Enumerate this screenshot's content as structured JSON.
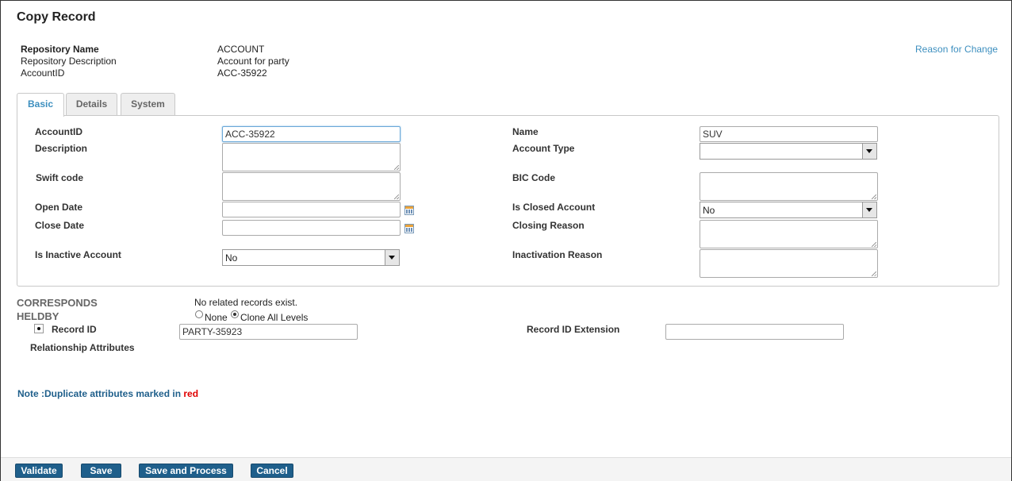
{
  "page": {
    "title": "Copy Record",
    "reason_link": "Reason for Change"
  },
  "meta": {
    "repo_name_label": "Repository Name",
    "repo_name_value": "ACCOUNT",
    "repo_desc_label": "Repository Description",
    "repo_desc_value": "Account for party",
    "account_id_label": "AccountID",
    "account_id_value": "ACC-35922"
  },
  "tabs": [
    {
      "label": "Basic"
    },
    {
      "label": "Details"
    },
    {
      "label": "System"
    }
  ],
  "form": {
    "account_id_label": "AccountID",
    "account_id_value": "ACC-35922",
    "description_label": "Description",
    "swift_label": "Swift code",
    "open_date_label": "Open Date",
    "close_date_label": "Close Date",
    "inactive_label": "Is Inactive Account",
    "inactive_value": "No",
    "name_label": "Name",
    "name_value": "SUV",
    "account_type_label": "Account Type",
    "account_type_value": "",
    "bic_label": "BIC Code",
    "closed_label": "Is Closed Account",
    "closed_value": "No",
    "closing_reason_label": "Closing Reason",
    "inactivation_reason_label": "Inactivation Reason"
  },
  "relationship": {
    "title_line1": "CORRESPONDS",
    "title_line2": "HELDBY",
    "no_records": "No related records exist.",
    "opt_none": "None",
    "opt_clone": "Clone All Levels",
    "record_id_label": "Record ID",
    "record_id_value": "PARTY-35923",
    "record_ext_label": "Record ID Extension",
    "record_ext_value": "",
    "attrs_label": "Relationship Attributes"
  },
  "note": {
    "text": "Note :Duplicate attributes marked in ",
    "red_word": "red",
    "colors": {
      "note": "#1f5f8b",
      "red": "#e00000"
    }
  },
  "buttons": {
    "validate": "Validate",
    "save": "Save",
    "save_process": "Save and Process",
    "cancel": "Cancel"
  },
  "colors": {
    "accent": "#3d8fbf",
    "button": "#1f5f8b"
  }
}
